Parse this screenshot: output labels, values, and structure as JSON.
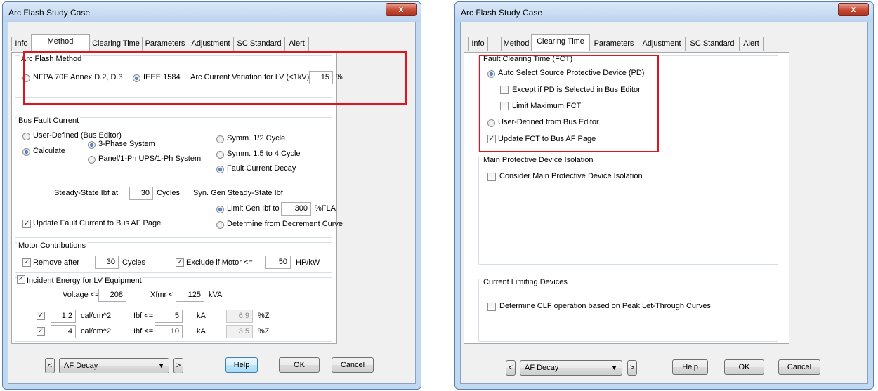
{
  "colors": {
    "highlight": "#e0141e",
    "title_bg": "#c2d9f2",
    "close": "#c44a34"
  },
  "left": {
    "title": "Arc Flash Study Case",
    "close": "x",
    "tabs": [
      "Info",
      "Method",
      "Clearing Time",
      "Parameters",
      "Adjustment",
      "SC Standard",
      "Alert"
    ],
    "active_tab": "Method",
    "arc_flash_method": {
      "label": "Arc Flash Method",
      "nfpa": "NFPA 70E Annex D.2, D.3",
      "ieee": "IEEE 1584",
      "variation_label": "Arc Current Variation for LV (<1kV)",
      "variation_value": "15",
      "variation_unit": "%"
    },
    "bus_fault": {
      "label": "Bus Fault Current",
      "user_defined": "User-Defined (Bus Editor)",
      "calculate": "Calculate",
      "three_phase": "3-Phase System",
      "panel": "Panel/1-Ph UPS/1-Ph System",
      "symm_half": "Symm. 1/2 Cycle",
      "symm_15": "Symm. 1.5 to 4 Cycle",
      "decay": "Fault Current Decay",
      "steady_label": "Steady-State Ibf at",
      "steady_value": "30",
      "steady_unit": "Cycles",
      "syn_gen": "Syn. Gen Steady-State Ibf",
      "limit_gen": "Limit Gen Ibf to",
      "limit_value": "300",
      "limit_unit": "%FLA",
      "update": "Update Fault Current to Bus AF Page",
      "decrement": "Determine from Decrement Curve"
    },
    "motor": {
      "label": "Motor Contributions",
      "remove": "Remove after",
      "remove_value": "30",
      "remove_unit": "Cycles",
      "exclude": "Exclude if Motor <=",
      "exclude_value": "50",
      "exclude_unit": "HP/kW"
    },
    "incident": {
      "label": "Incident Energy for LV Equipment",
      "voltage_label": "Voltage <=",
      "voltage_value": "208",
      "xfmr_label": "Xfmr <",
      "xfmr_value": "125",
      "xfmr_unit": "kVA",
      "rows": [
        {
          "cal": "1.2",
          "cal_unit": "cal/cm^2",
          "ibf_label": "Ibf <=",
          "ibf": "5",
          "ka": "kA",
          "z": "6.9",
          "z_unit": "%Z"
        },
        {
          "cal": "4",
          "cal_unit": "cal/cm^2",
          "ibf_label": "Ibf <=",
          "ibf": "10",
          "ka": "kA",
          "z": "3.5",
          "z_unit": "%Z"
        }
      ]
    },
    "footer": {
      "prev": "<",
      "next": ">",
      "case": "AF Decay",
      "help": "Help",
      "ok": "OK",
      "cancel": "Cancel"
    }
  },
  "right": {
    "title": "Arc Flash Study Case",
    "close": "x",
    "tabs": [
      "Info",
      "Method",
      "Clearing Time",
      "Parameters",
      "Adjustment",
      "SC Standard",
      "Alert"
    ],
    "active_tab": "Clearing Time",
    "fct": {
      "label": "Fault Clearing Time (FCT)",
      "auto": "Auto Select Source Protective Device (PD)",
      "except": "Except if PD is Selected in Bus Editor",
      "limit": "Limit Maximum FCT",
      "user": "User-Defined from Bus Editor",
      "update": "Update FCT to Bus AF Page"
    },
    "isolation": {
      "label": "Main Protective Device Isolation",
      "consider": "Consider Main Protective Device Isolation"
    },
    "limiting": {
      "label": "Current Limiting Devices",
      "determine": "Determine CLF operation based on Peak Let-Through Curves"
    },
    "footer": {
      "prev": "<",
      "next": ">",
      "case": "AF Decay",
      "help": "Help",
      "ok": "OK",
      "cancel": "Cancel"
    }
  }
}
